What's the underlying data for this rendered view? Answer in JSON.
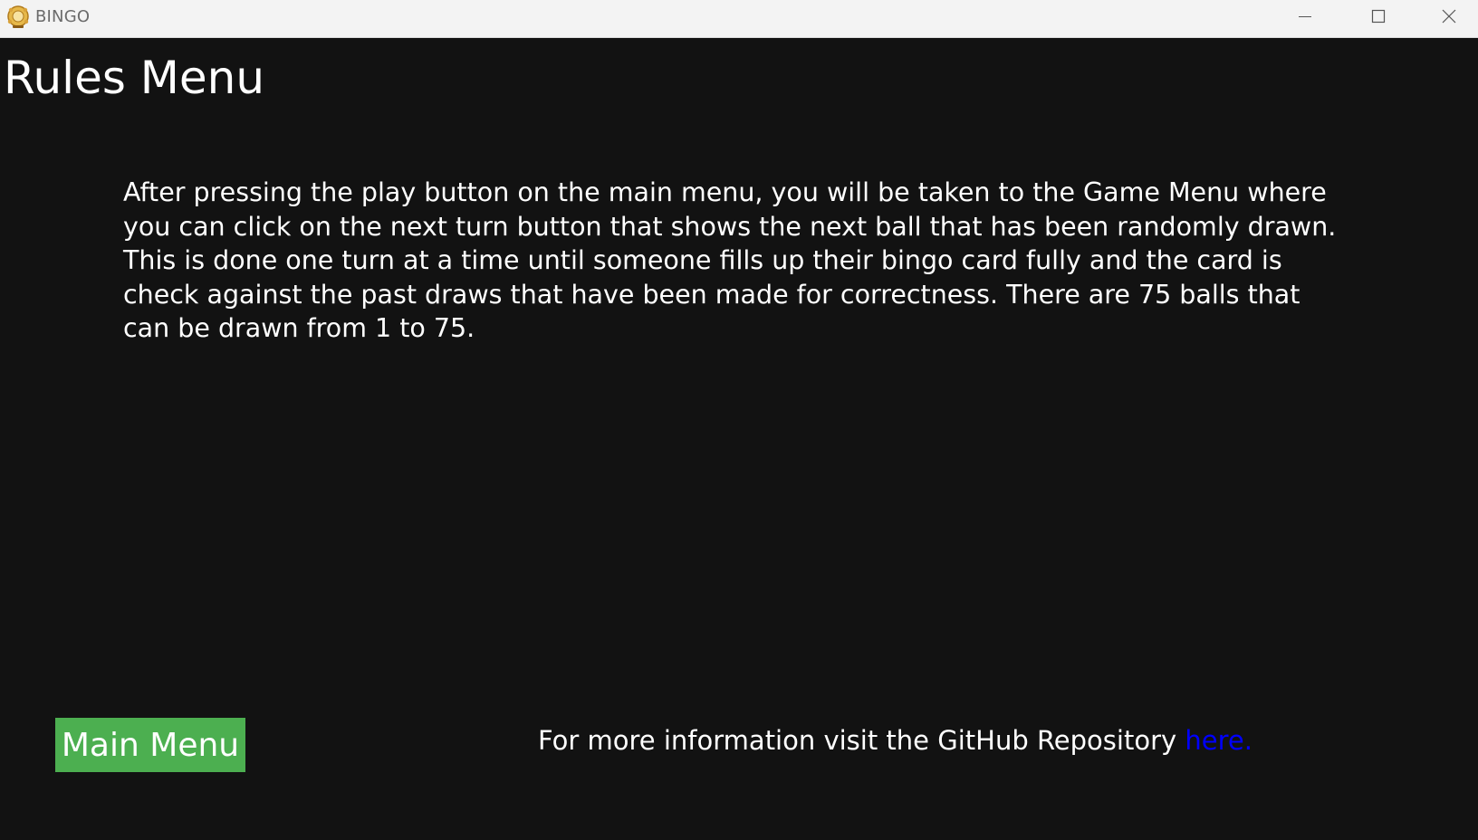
{
  "window": {
    "title": "BINGO",
    "controls": {
      "minimize_icon": "minimize-icon",
      "maximize_icon": "maximize-icon",
      "close_icon": "close-icon"
    }
  },
  "page": {
    "title": "Rules Menu",
    "rules_text": "After pressing the play button on the main menu, you will be taken to the Game Menu where you can click on the next turn button that shows the next ball that has been randomly drawn. This is done one turn at a time until someone fills up their bingo card fully and the card is check against the past draws that have been made for correctness. There are 75 balls that can be drawn from 1 to 75.",
    "main_menu_button": "Main Menu",
    "info_prefix": "For more information visit the GitHub Repository ",
    "info_link": "here."
  },
  "colors": {
    "background": "#121212",
    "titlebar": "#f3f3f3",
    "button": "#4caf50",
    "link": "#0000ff",
    "text": "#ffffff"
  }
}
